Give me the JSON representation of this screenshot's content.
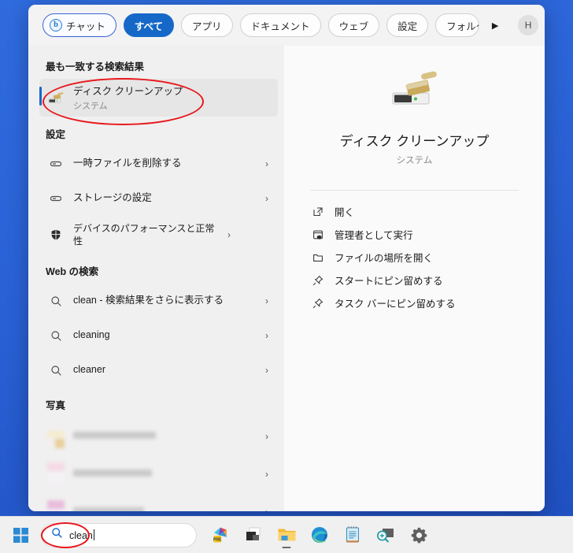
{
  "window": {
    "name": "windows-search-flyout"
  },
  "tabs": [
    {
      "label": "チャット",
      "name": "tab-chat",
      "style": "chat",
      "icon": "bing-b-icon"
    },
    {
      "label": "すべて",
      "name": "tab-all",
      "style": "active"
    },
    {
      "label": "アプリ",
      "name": "tab-apps",
      "style": "normal"
    },
    {
      "label": "ドキュメント",
      "name": "tab-documents",
      "style": "normal"
    },
    {
      "label": "ウェブ",
      "name": "tab-web",
      "style": "normal"
    },
    {
      "label": "設定",
      "name": "tab-settings",
      "style": "normal"
    },
    {
      "label": "フォルダー",
      "name": "tab-folders",
      "style": "truncated"
    }
  ],
  "tabbar": {
    "overflow_arrow": "▶",
    "avatar_initial": "H",
    "more_label": "…"
  },
  "sections": {
    "best_match": {
      "heading": "最も一致する検索結果",
      "item": {
        "title": "ディスク クリーンアップ",
        "subtitle": "システム",
        "icon": "disk-cleanup-icon"
      }
    },
    "settings": {
      "heading": "設定",
      "items": [
        {
          "title": "一時ファイルを削除する",
          "icon": "storage-icon",
          "chevron": "›"
        },
        {
          "title": "ストレージの設定",
          "icon": "storage-icon",
          "chevron": "›"
        },
        {
          "title": "デバイスのパフォーマンスと正常性",
          "icon": "shield-icon",
          "chevron": "›"
        }
      ]
    },
    "web": {
      "heading": "Web の検索",
      "items": [
        {
          "title": "clean - 検索結果をさらに表示する",
          "icon": "search-icon",
          "chevron": "›"
        },
        {
          "title": "cleaning",
          "icon": "search-icon",
          "chevron": "›"
        },
        {
          "title": "cleaner",
          "icon": "search-icon",
          "chevron": "›"
        }
      ]
    },
    "photos": {
      "heading": "写真",
      "items": [
        {
          "title": "",
          "icon": "photo-thumbnail",
          "chevron": "›",
          "redacted": "true"
        },
        {
          "title": "",
          "icon": "photo-thumbnail",
          "chevron": "›",
          "redacted": "true"
        },
        {
          "title": "",
          "icon": "photo-thumbnail",
          "chevron": "›",
          "redacted": "true"
        }
      ]
    }
  },
  "preview": {
    "icon": "disk-cleanup-icon",
    "title": "ディスク クリーンアップ",
    "subtitle": "システム",
    "actions": [
      {
        "label": "開く",
        "icon": "open-external-icon"
      },
      {
        "label": "管理者として実行",
        "icon": "run-as-admin-icon"
      },
      {
        "label": "ファイルの場所を開く",
        "icon": "folder-icon"
      },
      {
        "label": "スタートにピン留めする",
        "icon": "pin-icon"
      },
      {
        "label": "タスク バーにピン留めする",
        "icon": "pin-icon"
      }
    ]
  },
  "taskbar": {
    "start_label": "スタート",
    "search_query": "clean",
    "search_icon": "search-icon",
    "items": [
      {
        "name": "taskbar-start-button",
        "icon": "windows-logo-icon"
      },
      {
        "name": "taskbar-copilot-button",
        "icon": "office-copilot-icon"
      },
      {
        "name": "taskbar-taskview-button",
        "icon": "task-view-icon"
      },
      {
        "name": "taskbar-explorer-button",
        "icon": "file-explorer-icon"
      },
      {
        "name": "taskbar-edge-button",
        "icon": "edge-icon"
      },
      {
        "name": "taskbar-notepad-button",
        "icon": "notepad-icon"
      },
      {
        "name": "taskbar-magnifier-button",
        "icon": "magnifier-icon"
      },
      {
        "name": "taskbar-settings-button",
        "icon": "gear-icon"
      }
    ]
  },
  "annotations": [
    {
      "name": "annotation-best-match-ellipse",
      "shape": "ellipse",
      "color": "#e8171c"
    },
    {
      "name": "annotation-search-query-ellipse",
      "shape": "ellipse",
      "color": "#e8171c"
    }
  ]
}
